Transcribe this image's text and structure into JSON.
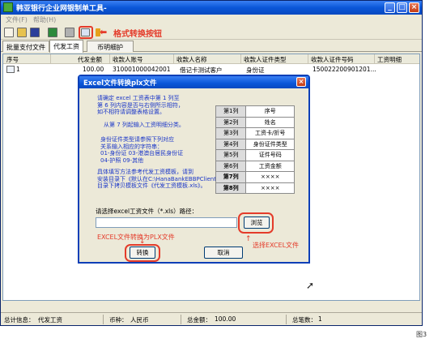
{
  "window": {
    "title": "韩亚银行企业网银制单工具-"
  },
  "menu": [
    "文件(F)",
    "帮助(H)"
  ],
  "toolbar": {
    "annotation": "格式转换按钮"
  },
  "tabs": [
    "批量支付文件",
    "代发工资",
    "币明细护"
  ],
  "table": {
    "headers": [
      "序号",
      "代发金额",
      "收款人账号",
      "收款人名称",
      "收款人证件类型",
      "收款人证件号码",
      "工资明细"
    ],
    "rows": [
      [
        "1",
        "100.00",
        "310001000042001",
        "借记卡测试客户",
        "身份证",
        "150022200901201...",
        ""
      ]
    ]
  },
  "status": {
    "total_label": "总计信息：",
    "total_value": "代发工资",
    "currency_label": "币种：",
    "currency_value": "人民币",
    "amount_label": "总金额：",
    "amount_value": "100.00",
    "count_label": "总笔数：",
    "count_value": "1"
  },
  "figure_label": "图3",
  "dialog": {
    "title": "Excel文件转换plx文件",
    "instructions_1": [
      "请确定 excel 工资表中第 1 列至",
      "第 6 列内容是否与右侧所示相符，",
      "如不相符请调整表格设置。"
    ],
    "instructions_2": "从第 7 列起输入工资明细分类。",
    "instructions_3": [
      "身份证件类型请参照下列对应",
      "关系输入相应的字符串：",
      "01-身份证    03-港澳台居民身份证",
      "04-护照       09-其他"
    ],
    "instructions_4": [
      "具体填写方法参考代发工资模板，请到",
      "安装目录下《默认在C:\\HanaBankEBBPClient》",
      "目录下拷贝模板文件《代发工资模板.xls》。"
    ],
    "mapping": [
      {
        "col": "第1列",
        "field": "序号"
      },
      {
        "col": "第2列",
        "field": "姓名"
      },
      {
        "col": "第3列",
        "field": "工资卡/折号"
      },
      {
        "col": "第4列",
        "field": "身份证件类型"
      },
      {
        "col": "第5列",
        "field": "证件号码"
      },
      {
        "col": "第6列",
        "field": "工资金额"
      },
      {
        "col": "第7列",
        "field": "××××"
      },
      {
        "col": "第8列",
        "field": "××××"
      }
    ],
    "path_label": "请选择excel工资文件（*.xls）路径：",
    "path_value": "",
    "browse_label": "浏览",
    "convert_label": "转换",
    "cancel_label": "取消",
    "annot_convert": "EXCEL文件转换为PLX文件",
    "annot_select": "选择EXCEL文件"
  }
}
